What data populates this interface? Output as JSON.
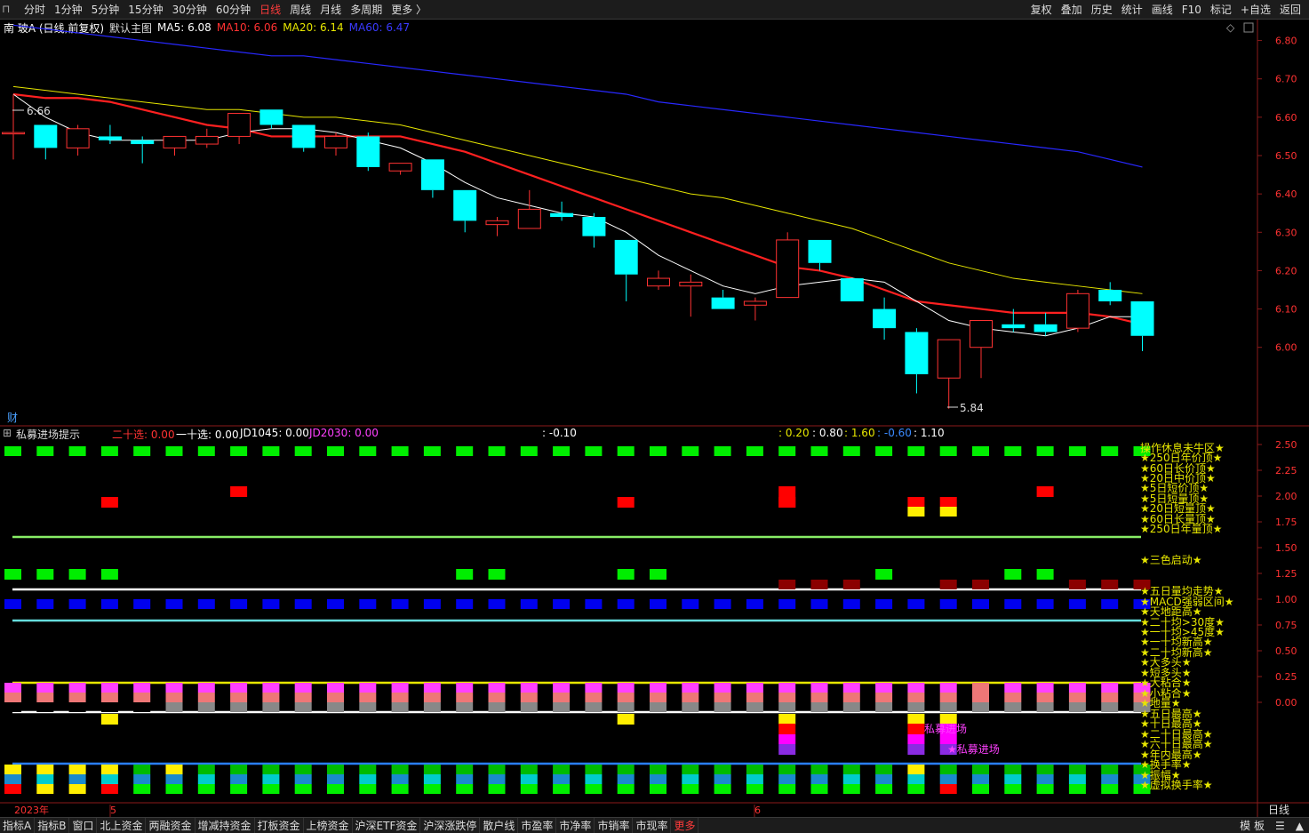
{
  "toolbar": {
    "periods": [
      "分时",
      "1分钟",
      "5分钟",
      "15分钟",
      "30分钟",
      "60分钟",
      "日线",
      "周线",
      "月线",
      "多周期",
      "更多 〉"
    ],
    "active_period": "日线",
    "right_buttons": [
      "复权",
      "叠加",
      "历史",
      "统计",
      "画线",
      "F10",
      "标记",
      "+自选",
      "返回"
    ]
  },
  "main_info": {
    "stock": "南 玻A (日线,前复权)",
    "template": "默认主图",
    "ma5": "MA5: 6.08",
    "ma10": "MA10: 6.06",
    "ma20": "MA20: 6.14",
    "ma60": "MA60: 6.47",
    "high_mark": "6.66",
    "low_mark": "5.84",
    "cai_label": "财",
    "diamond": "◇"
  },
  "indicator_info": {
    "name": "私募进场提示",
    "ershi": "二十选: 0.00",
    "yishi": "一十选: 0.00",
    "jd1045": "JD1045: 0.00",
    "jd2030": "JD2030: 0.00",
    "v1": ": -0.10",
    "v2": ": 0.20",
    "v3": ": 0.80",
    "v4": ": 1.60",
    "v5": ": -0.60",
    "v6": ": 1.10"
  },
  "price_axis": [
    "6.80",
    "6.70",
    "6.60",
    "6.50",
    "6.40",
    "6.30",
    "6.20",
    "6.10",
    "6.00"
  ],
  "ind_axis": [
    "2.50",
    "2.25",
    "2.00",
    "1.75",
    "1.50",
    "1.25",
    "1.00",
    "0.75",
    "0.50",
    "0.25",
    "0.00"
  ],
  "time_axis": {
    "year": "2023年",
    "m5": "5",
    "m6": "6",
    "right": "日线"
  },
  "ind_labels": [
    "操作休息未牛区★",
    "★250日年价顶★",
    "★60日长价顶★",
    "★20日中价顶★",
    "★5日短价顶★",
    "★5日短量顶★",
    "★20日短量顶★",
    "★60日长量顶★",
    "★250日年量顶★",
    "★三色启动★",
    "★五日量均走势★",
    "★MACD强弱区间★",
    "★天地距高★",
    "★二十均>30度★",
    "★一十均>45度★",
    "★一十均新高★",
    "★二十均新高★",
    "★大多头★",
    "★短多头★",
    "★大粘合★",
    "★小粘合★",
    "★地量★",
    "★五日最高★",
    "★十日最高★",
    "★二十日最高★",
    "★六十日最高★",
    "★年内最高★",
    "★换手率★",
    "★振幅★",
    "★虚拟换手率★"
  ],
  "signal_texts": [
    "私募进场",
    "★私募进场"
  ],
  "bottom_tabs": [
    "指标A",
    "指标B",
    "窗口",
    "北上资金",
    "两融资金",
    "增减持资金",
    "打板资金",
    "上榜资金",
    "沪深ETF资金",
    "沪深涨跌停",
    "散户线",
    "市盈率",
    "市净率",
    "市销率",
    "市现率",
    "更多"
  ],
  "bottom_right": [
    "模 板",
    "☰",
    "▲"
  ],
  "colors": {
    "up": "#ff3232",
    "down": "#00ffff",
    "ma5": "#ffffff",
    "ma10": "#ff2020",
    "ma20": "#e6e600",
    "ma60": "#2828ff"
  },
  "chart_data": {
    "type": "candlestick",
    "ylim": [
      5.8,
      6.85
    ],
    "candles": [
      {
        "o": 6.56,
        "c": 6.56,
        "h": 6.66,
        "l": 6.49
      },
      {
        "o": 6.58,
        "c": 6.52,
        "h": 6.58,
        "l": 6.49
      },
      {
        "o": 6.52,
        "c": 6.57,
        "h": 6.58,
        "l": 6.5
      },
      {
        "o": 6.55,
        "c": 6.54,
        "h": 6.58,
        "l": 6.53
      },
      {
        "o": 6.54,
        "c": 6.53,
        "h": 6.55,
        "l": 6.48
      },
      {
        "o": 6.52,
        "c": 6.55,
        "h": 6.55,
        "l": 6.5
      },
      {
        "o": 6.53,
        "c": 6.55,
        "h": 6.57,
        "l": 6.52
      },
      {
        "o": 6.55,
        "c": 6.61,
        "h": 6.61,
        "l": 6.53
      },
      {
        "o": 6.62,
        "c": 6.58,
        "h": 6.62,
        "l": 6.57
      },
      {
        "o": 6.58,
        "c": 6.52,
        "h": 6.58,
        "l": 6.51
      },
      {
        "o": 6.52,
        "c": 6.55,
        "h": 6.56,
        "l": 6.5
      },
      {
        "o": 6.55,
        "c": 6.47,
        "h": 6.56,
        "l": 6.46
      },
      {
        "o": 6.46,
        "c": 6.48,
        "h": 6.48,
        "l": 6.45
      },
      {
        "o": 6.49,
        "c": 6.41,
        "h": 6.49,
        "l": 6.39
      },
      {
        "o": 6.41,
        "c": 6.33,
        "h": 6.41,
        "l": 6.3
      },
      {
        "o": 6.32,
        "c": 6.33,
        "h": 6.34,
        "l": 6.29
      },
      {
        "o": 6.31,
        "c": 6.36,
        "h": 6.41,
        "l": 6.31
      },
      {
        "o": 6.35,
        "c": 6.34,
        "h": 6.38,
        "l": 6.33
      },
      {
        "o": 6.34,
        "c": 6.29,
        "h": 6.35,
        "l": 6.26
      },
      {
        "o": 6.28,
        "c": 6.19,
        "h": 6.28,
        "l": 6.12
      },
      {
        "o": 6.16,
        "c": 6.18,
        "h": 6.2,
        "l": 6.15
      },
      {
        "o": 6.16,
        "c": 6.17,
        "h": 6.19,
        "l": 6.08
      },
      {
        "o": 6.13,
        "c": 6.1,
        "h": 6.15,
        "l": 6.1
      },
      {
        "o": 6.11,
        "c": 6.12,
        "h": 6.13,
        "l": 6.07
      },
      {
        "o": 6.13,
        "c": 6.28,
        "h": 6.3,
        "l": 6.13
      },
      {
        "o": 6.28,
        "c": 6.22,
        "h": 6.28,
        "l": 6.2
      },
      {
        "o": 6.18,
        "c": 6.12,
        "h": 6.18,
        "l": 6.12
      },
      {
        "o": 6.1,
        "c": 6.05,
        "h": 6.13,
        "l": 6.02
      },
      {
        "o": 6.04,
        "c": 5.93,
        "h": 6.05,
        "l": 5.88
      },
      {
        "o": 5.92,
        "c": 6.02,
        "h": 6.02,
        "l": 5.84
      },
      {
        "o": 6.0,
        "c": 6.07,
        "h": 6.07,
        "l": 5.92
      },
      {
        "o": 6.06,
        "c": 6.05,
        "h": 6.1,
        "l": 6.04
      },
      {
        "o": 6.06,
        "c": 6.04,
        "h": 6.09,
        "l": 6.03
      },
      {
        "o": 6.05,
        "c": 6.14,
        "h": 6.15,
        "l": 6.04
      },
      {
        "o": 6.15,
        "c": 6.12,
        "h": 6.17,
        "l": 6.11
      },
      {
        "o": 6.12,
        "c": 6.03,
        "h": 6.12,
        "l": 5.99
      }
    ],
    "ma5": [
      6.66,
      6.6,
      6.56,
      6.54,
      6.54,
      6.54,
      6.54,
      6.56,
      6.57,
      6.57,
      6.56,
      6.54,
      6.52,
      6.48,
      6.43,
      6.39,
      6.37,
      6.35,
      6.34,
      6.3,
      6.24,
      6.2,
      6.16,
      6.14,
      6.16,
      6.17,
      6.18,
      6.17,
      6.12,
      6.07,
      6.05,
      6.04,
      6.03,
      6.05,
      6.08,
      6.08
    ],
    "ma10": [
      6.66,
      6.65,
      6.65,
      6.64,
      6.62,
      6.6,
      6.58,
      6.57,
      6.55,
      6.55,
      6.55,
      6.55,
      6.55,
      6.53,
      6.51,
      6.48,
      6.45,
      6.42,
      6.39,
      6.36,
      6.33,
      6.3,
      6.27,
      6.24,
      6.21,
      6.2,
      6.18,
      6.15,
      6.12,
      6.11,
      6.1,
      6.09,
      6.09,
      6.09,
      6.08,
      6.06
    ],
    "ma20": [
      6.68,
      6.67,
      6.66,
      6.65,
      6.64,
      6.63,
      6.62,
      6.62,
      6.61,
      6.6,
      6.6,
      6.59,
      6.58,
      6.56,
      6.54,
      6.52,
      6.5,
      6.48,
      6.46,
      6.44,
      6.42,
      6.4,
      6.39,
      6.37,
      6.35,
      6.33,
      6.31,
      6.28,
      6.25,
      6.22,
      6.2,
      6.18,
      6.17,
      6.16,
      6.15,
      6.14
    ],
    "ma60": [
      6.84,
      6.83,
      6.82,
      6.81,
      6.8,
      6.79,
      6.78,
      6.77,
      6.76,
      6.76,
      6.75,
      6.74,
      6.73,
      6.72,
      6.71,
      6.7,
      6.69,
      6.68,
      6.67,
      6.66,
      6.64,
      6.63,
      6.62,
      6.61,
      6.6,
      6.59,
      6.58,
      6.57,
      6.56,
      6.55,
      6.54,
      6.53,
      6.52,
      6.51,
      6.49,
      6.47
    ]
  }
}
